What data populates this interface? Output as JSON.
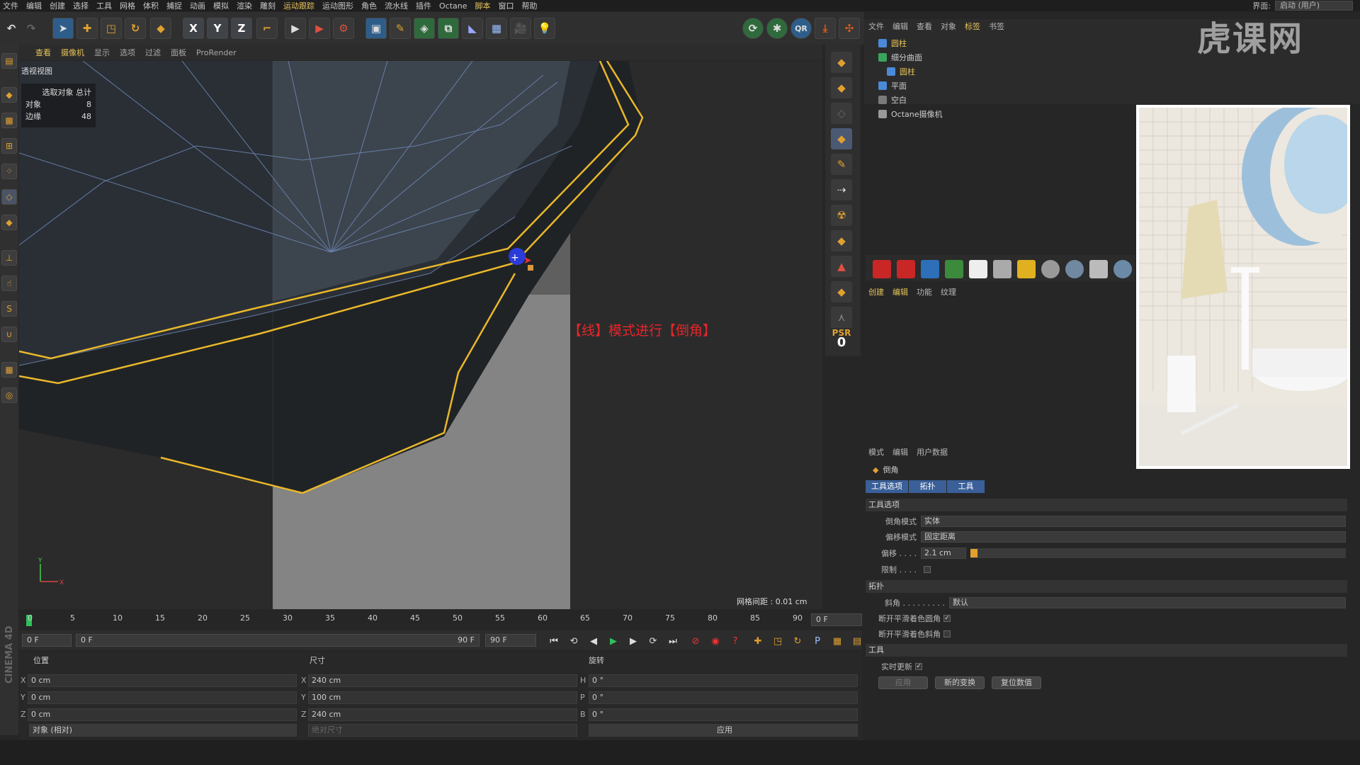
{
  "menubar": {
    "items": [
      "文件",
      "编辑",
      "创建",
      "选择",
      "工具",
      "网格",
      "体积",
      "捕捉",
      "动画",
      "模拟",
      "渲染",
      "雕刻",
      "运动跟踪",
      "运动图形",
      "角色",
      "流水线",
      "插件",
      "Octane",
      "脚本",
      "窗口",
      "帮助"
    ],
    "layout_label": "界面:",
    "layout_value": "启动 (用户)"
  },
  "viewport": {
    "menu": [
      "查看",
      "摄像机",
      "显示",
      "选项",
      "过滤",
      "面板",
      "ProRender"
    ],
    "label": "透视视图",
    "hud": {
      "title": "选取对象 总计",
      "objects_label": "对象",
      "objects_value": "8",
      "edges_label": "边缘",
      "edges_value": "48"
    },
    "annotation": "【线】模式进行【倒角】",
    "grid_spacing": "网格间距 : 0.01 cm"
  },
  "psr": {
    "label": "PSR",
    "value": "0"
  },
  "object_manager": {
    "menu": [
      "文件",
      "编辑",
      "查看",
      "对象",
      "标签",
      "书签"
    ],
    "objects": [
      "圆柱",
      "细分曲面",
      "圆柱",
      "平面",
      "空白",
      "Octane摄像机"
    ]
  },
  "watermark": "虎课网",
  "materials": {
    "menu": [
      "创建",
      "编辑",
      "功能",
      "纹理"
    ]
  },
  "attributes": {
    "menu": [
      "模式",
      "编辑",
      "用户数据"
    ],
    "tool_name": "倒角",
    "tabs": [
      "工具选项",
      "拓扑",
      "工具"
    ],
    "section_tool_options": "工具选项",
    "bevel_mode_label": "倒角模式",
    "bevel_mode_value": "实体",
    "offset_mode_label": "偏移模式",
    "offset_mode_value": "固定距离",
    "offset_label": "偏移 . . . .",
    "offset_value": "2.1 cm",
    "limit_label": "限制 . . . .",
    "section_topology": "拓扑",
    "miter_label": "斜角 . . . . . . . . .",
    "miter_value": "默认",
    "break_round_label": "断开平滑着色圆角",
    "break_miter_label": "断开平滑着色斜角",
    "section_tool": "工具",
    "realtime_label": "实时更新",
    "apply_label": "应用",
    "new_transform_label": "新的变换",
    "reset_label": "复位数值"
  },
  "timeline": {
    "ticks": [
      "0",
      "5",
      "10",
      "15",
      "20",
      "25",
      "30",
      "35",
      "40",
      "45",
      "50",
      "55",
      "60",
      "65",
      "70",
      "75",
      "80",
      "85",
      "90"
    ],
    "end_field": "0 F"
  },
  "transport": {
    "start": "0 F",
    "range_start": "0 F",
    "range_end": "90 F",
    "end": "90 F"
  },
  "coords": {
    "pos_header": "位置",
    "size_header": "尺寸",
    "rot_header": "旋转",
    "x_pos": "0 cm",
    "y_pos": "0 cm",
    "z_pos": "0 cm",
    "x_size": "240 cm",
    "y_size": "100 cm",
    "z_size": "240 cm",
    "h_rot": "0 °",
    "p_rot": "0 °",
    "b_rot": "0 °",
    "mode": "对象 (相对)",
    "size_mode": "绝对尺寸",
    "apply": "应用"
  },
  "side_label": "CINEMA 4D"
}
